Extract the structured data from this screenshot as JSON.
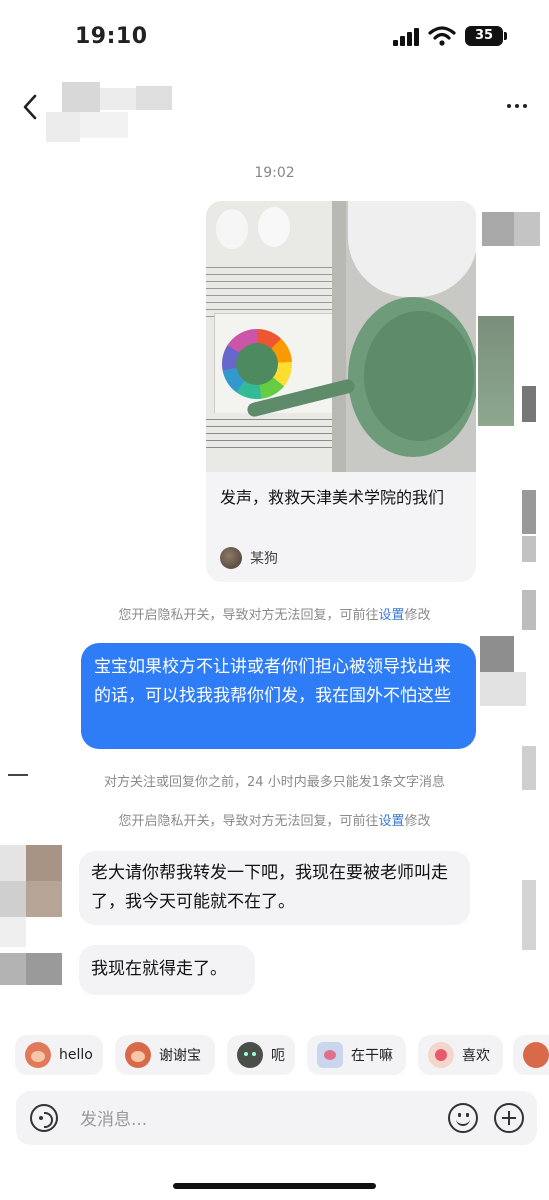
{
  "status_bar": {
    "time": "19:10",
    "battery": "35"
  },
  "chat": {
    "timestamp": "19:02",
    "shared_card": {
      "title": "发声，救救天津美术学院的我们",
      "author": "某狗"
    },
    "privacy_notice_prefix": "您开启隐私开关，导致对方无法回复，可前往",
    "privacy_notice_link": "设置",
    "privacy_notice_suffix": "修改",
    "outgoing_message": "宝宝如果校方不让讲或者你们担心被领导找出来的话，可以找我我帮你们发，我在国外不怕这些",
    "limit_notice": "对方关注或回复你之前，24 小时内最多只能发1条文字消息",
    "incoming_messages": [
      "老大请你帮我转发一下吧，我现在要被老师叫走了，我今天可能就不在了。",
      "我现在就得走了。"
    ]
  },
  "quick_replies": [
    "hello",
    "谢谢宝",
    "呃",
    "在干嘛",
    "喜欢"
  ],
  "input": {
    "placeholder": "发消息..."
  },
  "colors": {
    "accent": "#2f7df6",
    "link": "#3a7bd5",
    "bubble_in": "#f3f3f5"
  }
}
